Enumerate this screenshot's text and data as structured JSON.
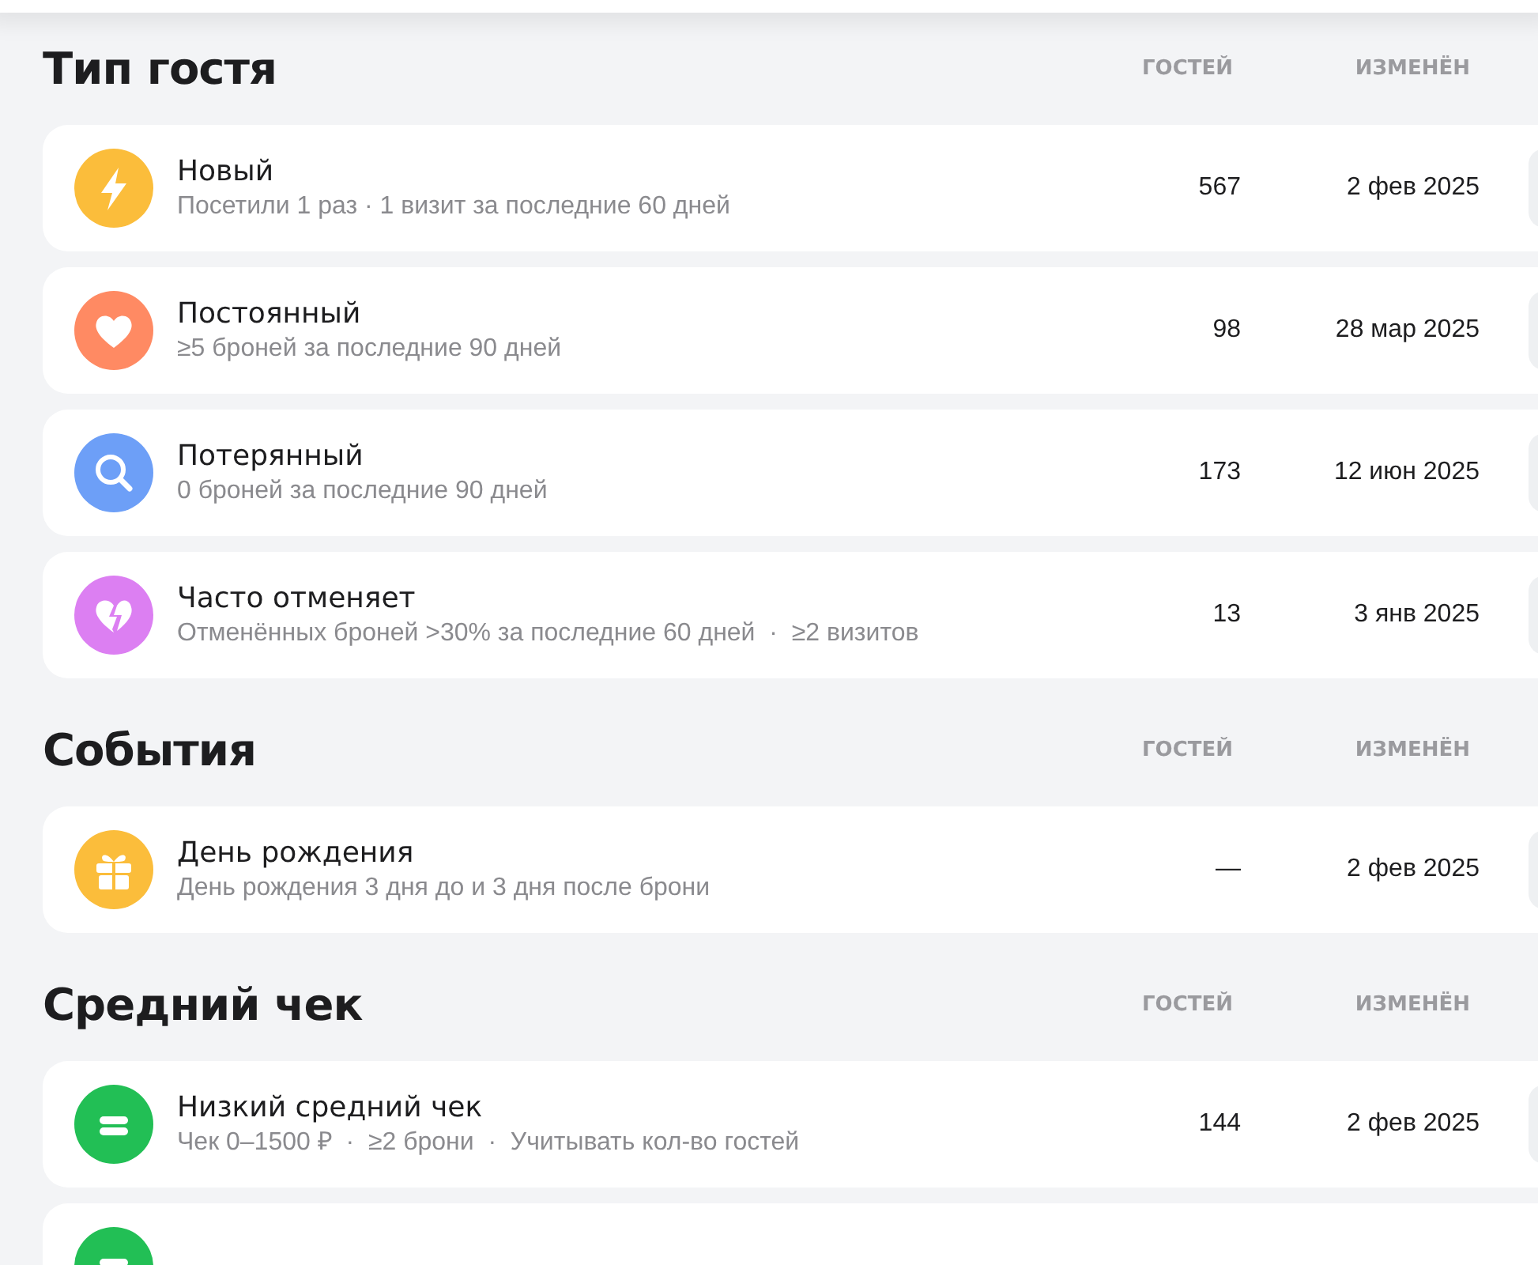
{
  "sections": [
    {
      "title": "Тип гостя",
      "columns": [
        "ГОСТЕЙ",
        "ИЗМЕНЁН"
      ],
      "items": [
        {
          "kind": "bolt",
          "color": "#fbbd3b",
          "name": "Новый",
          "description": "Посетили 1 раз · 1 визит за последние 60 дней",
          "guests": "567",
          "changed": "2 фев 2025"
        },
        {
          "kind": "heart",
          "color": "#ff8a63",
          "name": "Постоянный",
          "description": "≥5 броней за последние 90 дней",
          "guests": "98",
          "changed": "28 мар 2025"
        },
        {
          "kind": "search",
          "color": "#6d9ff7",
          "name": "Потерянный",
          "description": "0 броней за последние 90 дней",
          "guests": "173",
          "changed": "12 июн 2025"
        },
        {
          "kind": "broken-heart",
          "color": "#dc7ff2",
          "name": "Часто отменяет",
          "description": "Отменённых броней >30% за последние 60 дней  ·  ≥2 визитов",
          "guests": "13",
          "changed": "3 янв 2025"
        }
      ]
    },
    {
      "title": "События",
      "columns": [
        "ГОСТЕЙ",
        "ИЗМЕНЁН"
      ],
      "items": [
        {
          "kind": "gift",
          "color": "#fbbd3b",
          "name": "День рождения",
          "description": "День рождения 3 дня до и 3 дня после брони",
          "guests": "—",
          "changed": "2 фев 2025"
        }
      ]
    },
    {
      "title": "Средний чек",
      "columns": [
        "ГОСТЕЙ",
        "ИЗМЕНЁН"
      ],
      "items": [
        {
          "kind": "coins",
          "color": "#22bf55",
          "name": "Низкий средний чек",
          "description": "Чек 0–1500 ₽  ·  ≥2 брони  ·  Учитывать кол-во гостей",
          "guests": "144",
          "changed": "2 фев 2025"
        },
        {
          "kind": "coins",
          "color": "#22bf55"
        }
      ]
    }
  ]
}
